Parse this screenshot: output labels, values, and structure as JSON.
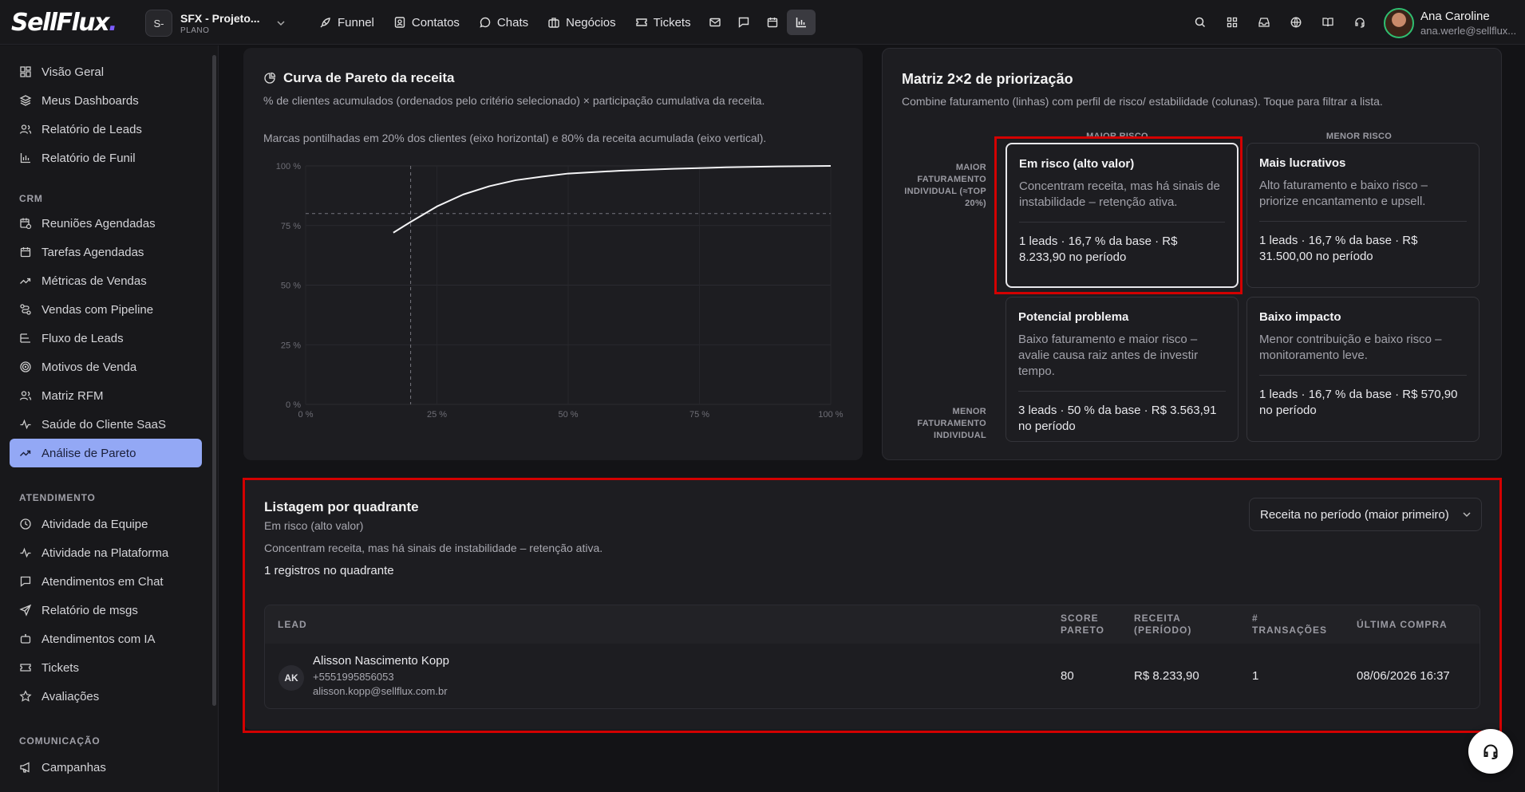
{
  "app": {
    "logo_text": "SellFlux",
    "brand_color": "#7c5cff"
  },
  "project": {
    "avatar": "S-",
    "name": "SFX - Projeto...",
    "plan": "PLANO"
  },
  "topnav": [
    {
      "label": "Funnel",
      "icon": "rocket-icon"
    },
    {
      "label": "Contatos",
      "icon": "contacts-icon"
    },
    {
      "label": "Chats",
      "icon": "chat-icon"
    },
    {
      "label": "Negócios",
      "icon": "briefcase-icon"
    },
    {
      "label": "Tickets",
      "icon": "ticket-icon"
    }
  ],
  "user": {
    "name": "Ana Caroline",
    "email": "ana.werle@sellflux..."
  },
  "sidebar": {
    "items_top": [
      "Visão Geral",
      "Meus Dashboards",
      "Relatório de Leads",
      "Relatório de Funil"
    ],
    "crm_label": "CRM",
    "crm_items": [
      "Reuniões Agendadas",
      "Tarefas Agendadas",
      "Métricas de Vendas",
      "Vendas com Pipeline",
      "Fluxo de Leads",
      "Motivos de Venda",
      "Matriz RFM",
      "Saúde do Cliente SaaS",
      "Análise de Pareto"
    ],
    "atendimento_label": "ATENDIMENTO",
    "atendimento_items": [
      "Atividade da Equipe",
      "Atividade na Plataforma",
      "Atendimentos em Chat",
      "Relatório de msgs",
      "Atendimentos com IA",
      "Tickets",
      "Avaliações"
    ],
    "comunicacao_label": "COMUNICAÇÃO",
    "comunicacao_items": [
      "Campanhas"
    ],
    "active": "Análise de Pareto",
    "active_color": "#93a8f5"
  },
  "pareto": {
    "title": "Curva de Pareto da receita",
    "subtitle": "% de clientes acumulados (ordenados pelo critério selecionado) × participação cumulativa da receita.",
    "note": "Marcas pontilhadas em 20% dos clientes (eixo horizontal) e 80% da receita acumulada (eixo vertical)."
  },
  "chart_data": {
    "type": "line",
    "title": "Curva de Pareto da receita",
    "x_ticks": [
      "0 %",
      "25 %",
      "50 %",
      "75 %",
      "100 %"
    ],
    "y_ticks": [
      "0 %",
      "25 %",
      "50 %",
      "75 %",
      "100 %"
    ],
    "xlim": [
      0,
      100
    ],
    "ylim": [
      0,
      100
    ],
    "series": [
      {
        "x": [
          16.7,
          20,
          25,
          30,
          35,
          40,
          45,
          50,
          60,
          70,
          80,
          90,
          100
        ],
        "y": [
          72,
          76.5,
          83,
          88,
          91.5,
          94,
          95.5,
          96.8,
          98,
          98.8,
          99.4,
          99.8,
          100
        ]
      }
    ],
    "reference_lines": {
      "x": 20,
      "y": 80
    },
    "grid": true
  },
  "matrix": {
    "title": "Matriz 2×2 de priorização",
    "subtitle": "Combine faturamento (linhas) com perfil de risco/ estabilidade (colunas). Toque para filtrar a lista.",
    "col_high_risk": "MAIOR RISCO",
    "col_low_risk": "MENOR RISCO",
    "row_high": "MAIOR FATURAMENTO INDIVIDUAL (≈TOP 20%)",
    "row_low": "MENOR FATURAMENTO INDIVIDUAL",
    "quadrants": [
      {
        "title": "Em risco (alto valor)",
        "desc": "Concentram receita, mas há sinais de instabilidade – retenção ativa.",
        "stats": "1 leads · 16,7 % da base · R$ 8.233,90 no período"
      },
      {
        "title": "Mais lucrativos",
        "desc": "Alto faturamento e baixo risco – priorize encantamento e upsell.",
        "stats": "1 leads · 16,7 % da base · R$ 31.500,00 no período"
      },
      {
        "title": "Potencial problema",
        "desc": "Baixo faturamento e maior risco – avalie causa raiz antes de investir tempo.",
        "stats": "3 leads · 50 % da base · R$ 3.563,91 no período"
      },
      {
        "title": "Baixo impacto",
        "desc": "Menor contribuição e baixo risco – monitoramento leve.",
        "stats": "1 leads · 16,7 % da base · R$ 570,90 no período"
      }
    ]
  },
  "listing": {
    "title": "Listagem por quadrante",
    "quadrant": "Em risco (alto valor)",
    "desc": "Concentram receita, mas há sinais de instabilidade – retenção ativa.",
    "count": "1 registros no quadrante",
    "sort": "Receita no período (maior primeiro)",
    "columns": [
      "LEAD",
      "SCORE PARETO",
      "RECEITA (PERÍODO)",
      "# TRANSAÇÕES",
      "ÚLTIMA COMPRA"
    ],
    "rows": [
      {
        "initials": "AK",
        "name": "Alisson Nascimento Kopp",
        "phone": "+5551995856053",
        "email": "alisson.kopp@sellflux.com.br",
        "score": "80",
        "revenue": "R$ 8.233,90",
        "transactions": "1",
        "last": "08/06/2026 16:37"
      }
    ]
  }
}
